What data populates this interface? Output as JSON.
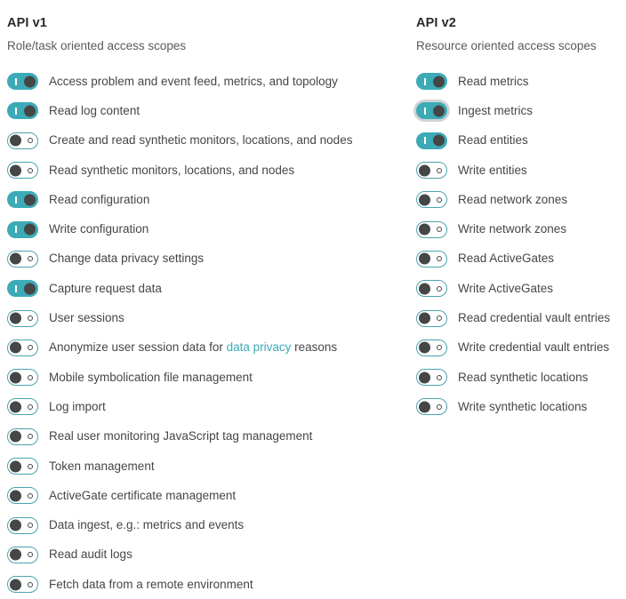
{
  "colors": {
    "accent_teal": "#3cabb7",
    "knob_dark": "#454646",
    "text": "#454646",
    "title": "#2b2b2b",
    "background": "#ffffff",
    "focus_ring": "#d3d3d3"
  },
  "columns": [
    {
      "id": "api-v1",
      "title": "API v1",
      "subtitle": "Role/task oriented access scopes",
      "scopes": [
        {
          "label": "Access problem and event feed, metrics, and topology",
          "state": "on",
          "focused": false
        },
        {
          "label": "Read log content",
          "state": "on",
          "focused": false
        },
        {
          "label": "Create and read synthetic monitors, locations, and nodes",
          "state": "off",
          "focused": false
        },
        {
          "label": "Read synthetic monitors, locations, and nodes",
          "state": "off",
          "focused": false
        },
        {
          "label": "Read configuration",
          "state": "on",
          "focused": false
        },
        {
          "label": "Write configuration",
          "state": "on",
          "focused": false
        },
        {
          "label": "Change data privacy settings",
          "state": "off",
          "focused": false
        },
        {
          "label": "Capture request data",
          "state": "on",
          "focused": false
        },
        {
          "label": "User sessions",
          "state": "off",
          "focused": false
        },
        {
          "label": "Anonymize user session data for ",
          "link_text": "data privacy",
          "label_suffix": " reasons",
          "state": "off",
          "focused": false
        },
        {
          "label": "Mobile symbolication file management",
          "state": "off",
          "focused": false
        },
        {
          "label": "Log import",
          "state": "off",
          "focused": false
        },
        {
          "label": "Real user monitoring JavaScript tag management",
          "state": "off",
          "focused": false
        },
        {
          "label": "Token management",
          "state": "off",
          "focused": false
        },
        {
          "label": "ActiveGate certificate management",
          "state": "off",
          "focused": false
        },
        {
          "label": "Data ingest, e.g.: metrics and events",
          "state": "off",
          "focused": false
        },
        {
          "label": "Read audit logs",
          "state": "off",
          "focused": false
        },
        {
          "label": "Fetch data from a remote environment",
          "state": "off",
          "focused": false
        }
      ]
    },
    {
      "id": "api-v2",
      "title": "API v2",
      "subtitle": "Resource oriented access scopes",
      "scopes": [
        {
          "label": "Read metrics",
          "state": "on",
          "focused": false
        },
        {
          "label": "Ingest metrics",
          "state": "on",
          "focused": true
        },
        {
          "label": "Read entities",
          "state": "on",
          "focused": false
        },
        {
          "label": "Write entities",
          "state": "off",
          "focused": false
        },
        {
          "label": "Read network zones",
          "state": "off",
          "focused": false
        },
        {
          "label": "Write network zones",
          "state": "off",
          "focused": false
        },
        {
          "label": "Read ActiveGates",
          "state": "off",
          "focused": false
        },
        {
          "label": "Write ActiveGates",
          "state": "off",
          "focused": false
        },
        {
          "label": "Read credential vault entries",
          "state": "off",
          "focused": false
        },
        {
          "label": "Write credential vault entries",
          "state": "off",
          "focused": false
        },
        {
          "label": "Read synthetic locations",
          "state": "off",
          "focused": false
        },
        {
          "label": "Write synthetic locations",
          "state": "off",
          "focused": false
        }
      ]
    }
  ]
}
